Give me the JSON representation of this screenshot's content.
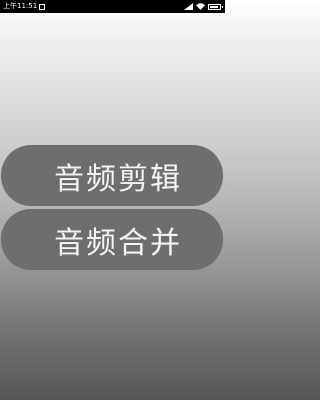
{
  "status_bar": {
    "time": "上午11:51",
    "battery_level": 0.85
  },
  "main": {
    "buttons": [
      {
        "label": "音频剪辑"
      },
      {
        "label": "音频合并"
      }
    ]
  }
}
